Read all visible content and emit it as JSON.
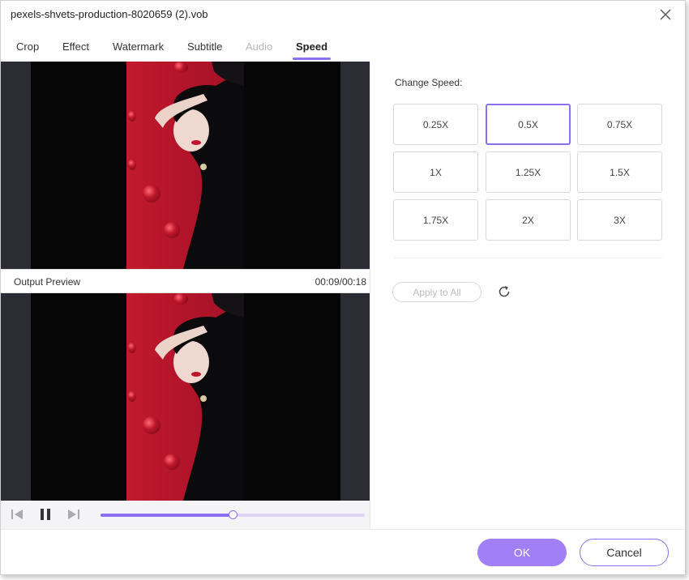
{
  "window": {
    "title": "pexels-shvets-production-8020659 (2).vob"
  },
  "tabs": [
    {
      "label": "Crop",
      "state": "normal"
    },
    {
      "label": "Effect",
      "state": "normal"
    },
    {
      "label": "Watermark",
      "state": "normal"
    },
    {
      "label": "Subtitle",
      "state": "normal"
    },
    {
      "label": "Audio",
      "state": "disabled"
    },
    {
      "label": "Speed",
      "state": "active"
    }
  ],
  "preview": {
    "output_label": "Output Preview",
    "time": "00:09/00:18",
    "progress_fraction": 0.5,
    "playing": true
  },
  "speed": {
    "label": "Change Speed:",
    "options": [
      "0.25X",
      "0.5X",
      "0.75X",
      "1X",
      "1.25X",
      "1.5X",
      "1.75X",
      "2X",
      "3X"
    ],
    "selected": "0.5X",
    "apply_all_label": "Apply to All"
  },
  "footer": {
    "ok_label": "OK",
    "cancel_label": "Cancel"
  },
  "colors": {
    "accent": "#8b6ff0",
    "ok_button": "#a07ff7",
    "video_background": "#c21a2e",
    "letterbox": "#060607"
  },
  "icons": {
    "close": "close-icon",
    "previous_frame": "previous-frame-icon",
    "pause": "pause-icon",
    "next_frame": "next-frame-icon",
    "reset": "reset-icon"
  }
}
